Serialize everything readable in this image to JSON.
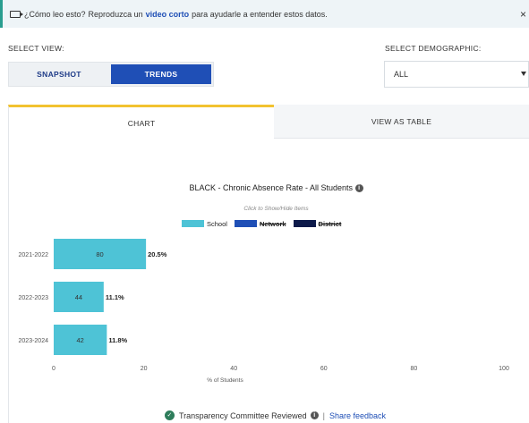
{
  "banner": {
    "question": "¿Cómo leo esto?",
    "text_before": "Reproduzca un",
    "link": "video corto",
    "text_after": "para ayudarle a entender estos datos.",
    "close": "×"
  },
  "view": {
    "label": "SELECT VIEW:",
    "options": [
      "SNAPSHOT",
      "TRENDS"
    ],
    "selected": "TRENDS"
  },
  "demographic": {
    "label": "SELECT DEMOGRAPHIC:",
    "value": "ALL"
  },
  "tabs": [
    "CHART",
    "VIEW AS TABLE"
  ],
  "footer": {
    "reviewed": "Transparency Committee Reviewed",
    "separator": "|",
    "feedback": "Share feedback"
  },
  "colors": {
    "school": "#4ec3d6",
    "network": "#1f4fb6",
    "district": "#0d1a4a",
    "accent": "#f2c230"
  },
  "chart_data": {
    "type": "bar",
    "orientation": "horizontal",
    "title": "BLACK - Chronic Absence Rate - All Students",
    "hint": "Click to Show/Hide Items",
    "xlabel": "% of Students",
    "xlim": [
      0,
      100
    ],
    "xticks": [
      "0",
      "20",
      "40",
      "60",
      "80",
      "100"
    ],
    "legend": [
      {
        "name": "School",
        "hidden": false
      },
      {
        "name": "Network",
        "hidden": true
      },
      {
        "name": "District",
        "hidden": true
      }
    ],
    "categories": [
      "2021-2022",
      "2022-2023",
      "2023-2024"
    ],
    "series": [
      {
        "name": "School",
        "values": [
          20.5,
          11.1,
          11.8
        ],
        "value_labels": [
          "20.5%",
          "11.1%",
          "11.8%"
        ],
        "counts": [
          "80",
          "44",
          "42"
        ]
      }
    ]
  }
}
